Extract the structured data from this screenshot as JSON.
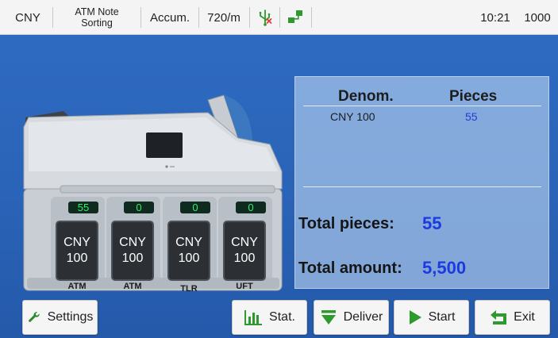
{
  "status_bar": {
    "currency": "CNY",
    "mode_line1": "ATM Note",
    "mode_line2": "Sorting",
    "count_mode": "Accum.",
    "speed": "720/m",
    "time": "10:21",
    "batch": "1000"
  },
  "machine": {
    "bins": [
      {
        "index": "01",
        "count": "55",
        "currency": "CNY",
        "denom": "100",
        "label": "ATM"
      },
      {
        "index": "02",
        "count": "0",
        "currency": "CNY",
        "denom": "100",
        "label": "ATM"
      },
      {
        "index": "03",
        "count": "0",
        "currency": "CNY",
        "denom": "100",
        "label": "TLR"
      },
      {
        "index": "04",
        "count": "0",
        "currency": "CNY",
        "denom": "100",
        "label": "UFT"
      }
    ]
  },
  "stats": {
    "col_denom": "Denom.",
    "col_pieces": "Pieces",
    "rows": [
      {
        "denom": "CNY 100",
        "pieces": "55"
      }
    ],
    "total_pieces_label": "Total pieces:",
    "total_pieces": "55",
    "total_amount_label": "Total amount:",
    "total_amount": "5,500"
  },
  "buttons": {
    "settings": "Settings",
    "stat": "Stat.",
    "deliver": "Deliver",
    "start": "Start",
    "exit": "Exit"
  },
  "colors": {
    "background": "#2a64b8",
    "count_green": "#2df06a",
    "value_blue": "#1c3ae0",
    "icon_green": "#2e9a2e"
  }
}
